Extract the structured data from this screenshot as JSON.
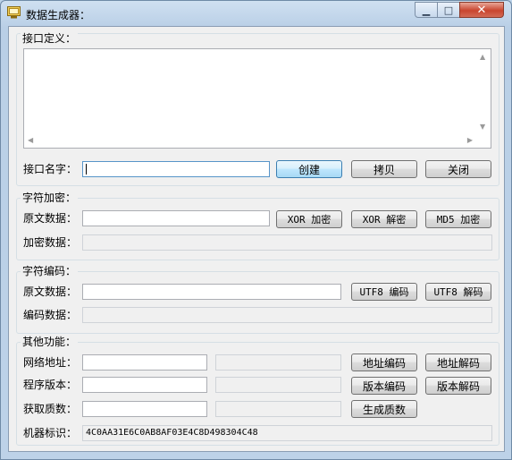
{
  "window": {
    "title": "数据生成器："
  },
  "interface_def": {
    "group_label": "接口定义：",
    "name_label": "接口名字：",
    "name_value": "",
    "buttons": {
      "create": "创建",
      "copy": "拷贝",
      "close": "关闭"
    }
  },
  "encrypt": {
    "group_label": "字符加密：",
    "source_label": "原文数据：",
    "source_value": "",
    "result_label": "加密数据：",
    "result_value": "",
    "buttons": {
      "xor_encrypt": "XOR 加密",
      "xor_decrypt": "XOR 解密",
      "md5_encrypt": "MD5 加密"
    }
  },
  "encode": {
    "group_label": "字符编码：",
    "source_label": "原文数据：",
    "source_value": "",
    "result_label": "编码数据：",
    "result_value": "",
    "buttons": {
      "utf8_encode": "UTF8 编码",
      "utf8_decode": "UTF8 解码"
    }
  },
  "other": {
    "group_label": "其他功能：",
    "url_label": "网络地址：",
    "version_label": "程序版本：",
    "prime_label": "获取质数：",
    "machine_label": "机器标识：",
    "machine_value": "4C0AA31E6C0AB8AF03E4C8D498304C48",
    "buttons": {
      "url_encode": "地址编码",
      "url_decode": "地址解码",
      "ver_encode": "版本编码",
      "ver_decode": "版本解码",
      "gen_prime": "生成质数"
    }
  }
}
